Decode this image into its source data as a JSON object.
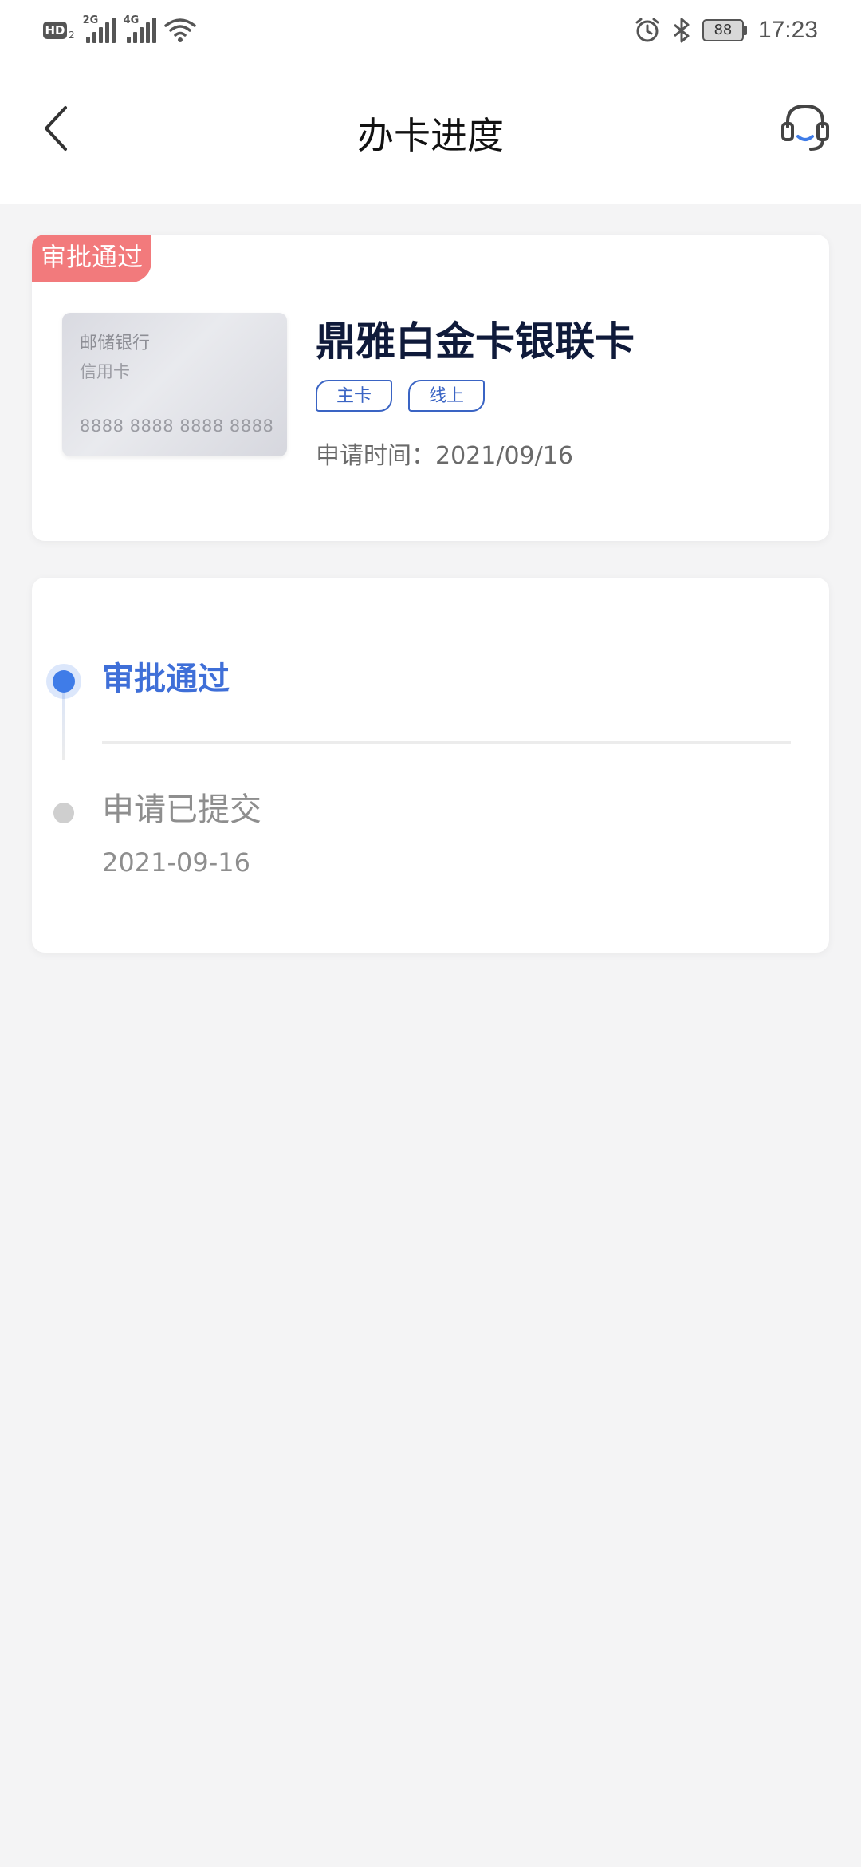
{
  "status_bar": {
    "hd_label": "HD",
    "hd_sub": "2",
    "network_1": "2G",
    "network_2": "4G",
    "battery": "88",
    "time": "17:23",
    "icons": [
      "hd-icon",
      "signal-icon",
      "wifi-icon",
      "alarm-icon",
      "bluetooth-icon",
      "battery-icon"
    ]
  },
  "nav": {
    "title": "办卡进度",
    "back_icon": "back-chevron-icon",
    "service_icon": "customer-service-headset-icon"
  },
  "card": {
    "status": "审批通过",
    "image_bank": "邮储银行",
    "image_type": "信用卡",
    "image_number": "8888 8888 8888 8888",
    "name": "鼎雅白金卡银联卡",
    "tags": [
      "主卡",
      "线上"
    ],
    "apply_time": "申请时间：2021/09/16"
  },
  "timeline": {
    "steps": [
      {
        "label": "审批通过",
        "date": "",
        "active": true
      },
      {
        "label": "申请已提交",
        "date": "2021-09-16",
        "active": false
      }
    ]
  },
  "colors": {
    "accent": "#3f6fd8",
    "ribbon": "#f27a7c",
    "title_dark": "#0f1a3a",
    "background": "#f4f4f5"
  }
}
